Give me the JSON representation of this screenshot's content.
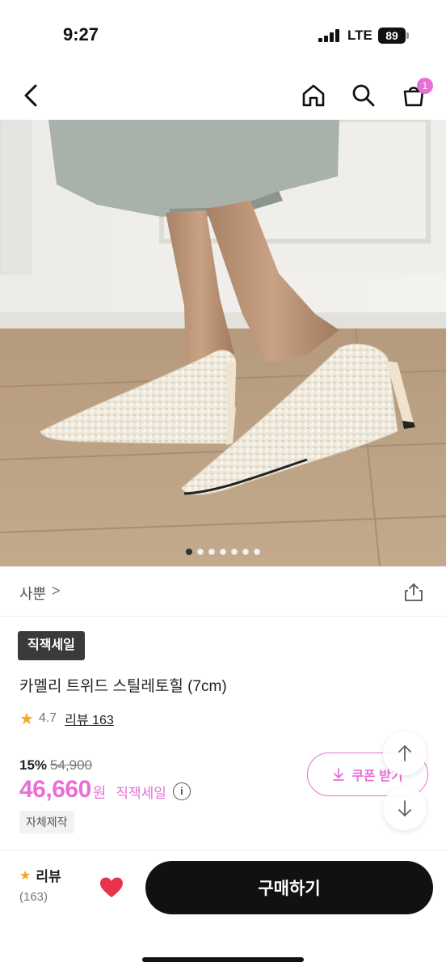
{
  "status_bar": {
    "time": "9:27",
    "network": "LTE",
    "battery": "89"
  },
  "nav": {
    "cart_count": "1"
  },
  "gallery": {
    "total_images": 7,
    "active_index": 0
  },
  "brand": {
    "name": "사뿐",
    "chevron": ">"
  },
  "product": {
    "sale_badge": "직잭세일",
    "title": "카멜리 트위드 스틸레토힐 (7cm)",
    "rating": "4.7",
    "review_link": "리뷰 163",
    "discount_rate": "15%",
    "original_price": "54,900",
    "sale_price": "46,660",
    "currency": "원",
    "sale_type": "직잭세일",
    "tag": "자체제작"
  },
  "coupon": {
    "label": "쿠폰 받기"
  },
  "bottom_bar": {
    "review_label": "리뷰",
    "review_count": "(163)",
    "buy_label": "구매하기"
  },
  "colors": {
    "accent": "#e86fd6",
    "star": "#f5a623",
    "heart": "#e8334a",
    "dark": "#111111"
  }
}
